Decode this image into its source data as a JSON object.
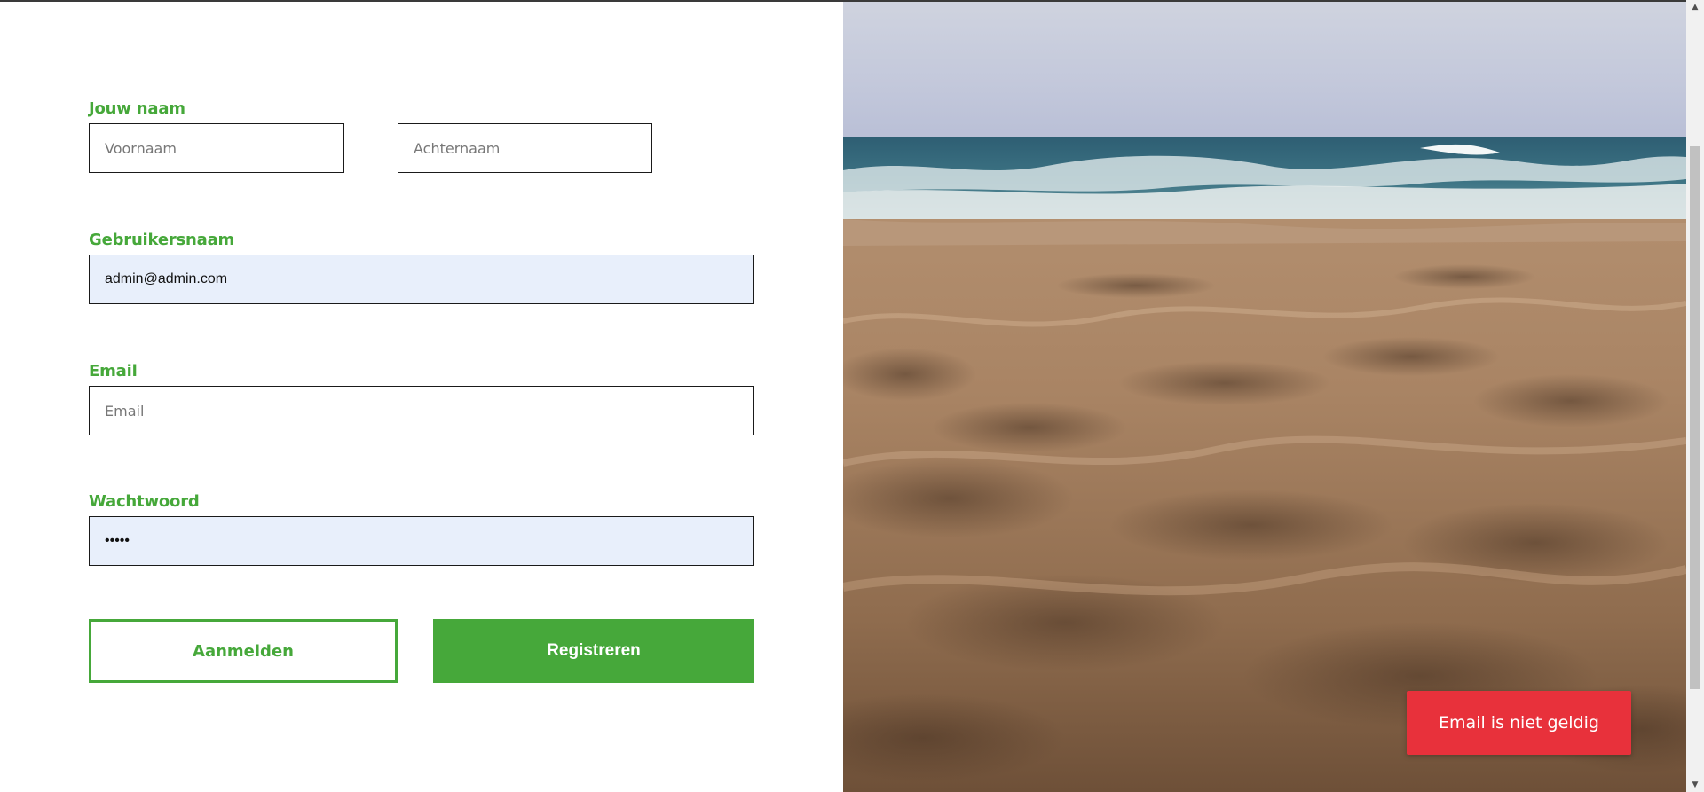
{
  "form": {
    "name_label": "Jouw naam",
    "first_name_placeholder": "Voornaam",
    "last_name_placeholder": "Achternaam",
    "username_label": "Gebruikersnaam",
    "username_value": "admin@admin.com",
    "email_label": "Email",
    "email_placeholder": "Email",
    "password_label": "Wachtwoord",
    "password_value": "admin",
    "login_button": "Aanmelden",
    "register_button": "Registreren"
  },
  "toast": {
    "message": "Email is niet geldig",
    "color": "#e8313b"
  },
  "theme": {
    "accent": "#46a83a"
  },
  "photo": {
    "subject": "beach-sand-and-sea-photo"
  }
}
